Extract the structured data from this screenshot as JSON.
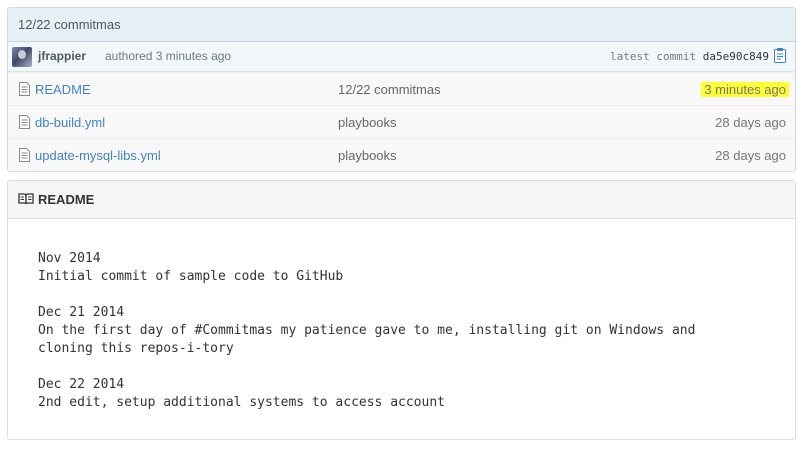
{
  "commit": {
    "title": "12/22 commitmas",
    "author": "jfrappier",
    "authored_text": "authored 3 minutes ago",
    "latest_label": "latest commit",
    "sha": "da5e90c849"
  },
  "files": [
    {
      "name": "README",
      "message": "12/22 commitmas",
      "age": "3 minutes ago",
      "highlight": true
    },
    {
      "name": "db-build.yml",
      "message": "playbooks",
      "age": "28 days ago",
      "highlight": false
    },
    {
      "name": "update-mysql-libs.yml",
      "message": "playbooks",
      "age": "28 days ago",
      "highlight": false
    }
  ],
  "readme": {
    "heading": "README",
    "lines": [
      "Nov 2014",
      "Initial commit of sample code to GitHub",
      "",
      "Dec 21 2014",
      "On the first day of #Commitmas my patience gave to me, installing git on Windows and",
      "cloning this repos-i-tory",
      "",
      "Dec 22 2014",
      "2nd edit, setup additional systems to access account"
    ]
  },
  "colors": {
    "link": "#4183c4",
    "highlight": "#ffff33",
    "commit_bar": "#e6f1f6"
  },
  "icons": {
    "file": "file-text-icon",
    "clipboard": "clipboard-icon",
    "book": "book-icon"
  }
}
